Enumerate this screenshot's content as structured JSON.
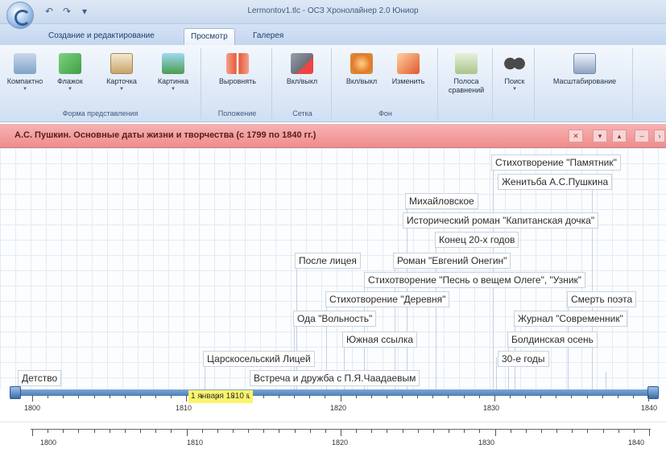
{
  "window": {
    "title": "Lermontov1.tlc - ОСЗ Хронолайнер 2.0 Юниор",
    "qat_undo": "↶",
    "qat_redo": "↷",
    "qat_more": "▾"
  },
  "tabs": [
    {
      "label": "Создание и редактирование",
      "active": false
    },
    {
      "label": "Просмотр",
      "active": true
    },
    {
      "label": "Галерея",
      "active": false
    }
  ],
  "ribbon": {
    "groups": [
      {
        "label": "Форма представления",
        "buttons": [
          {
            "label": "Компактно",
            "icon": "compact-view-icon",
            "color": "#7fa3c9"
          },
          {
            "label": "Флажок",
            "icon": "flag-icon",
            "color": "#3f9d45"
          },
          {
            "label": "Карточка",
            "icon": "card-icon",
            "color": "#c7a46a"
          },
          {
            "label": "Картинка",
            "icon": "picture-icon",
            "color": "#4a9d4f"
          }
        ]
      },
      {
        "label": "Положение",
        "buttons": [
          {
            "label": "Выровнять",
            "icon": "align-icon",
            "color": "#e55a3a"
          }
        ]
      },
      {
        "label": "Сетка",
        "buttons": [
          {
            "label": "Вкл/выкл",
            "icon": "grid-toggle-icon",
            "color": "#6b6f7a"
          }
        ]
      },
      {
        "label": "Фон",
        "buttons": [
          {
            "label": "Вкл/выкл",
            "icon": "background-toggle-icon",
            "color": "#e27a2a"
          },
          {
            "label": "Изменить",
            "icon": "background-edit-icon",
            "color": "#e0572f"
          }
        ]
      },
      {
        "label": "",
        "buttons": [
          {
            "label": "Полоса сравнений",
            "icon": "compare-strip-icon",
            "color": "#a9c58b"
          }
        ]
      },
      {
        "label": "",
        "buttons": [
          {
            "label": "Поиск",
            "icon": "binoculars-icon",
            "color": "#4a4a4a"
          }
        ]
      },
      {
        "label": "",
        "buttons": [
          {
            "label": "Масштабирование",
            "icon": "zoom-icon",
            "color": "#8da4c3"
          }
        ]
      }
    ]
  },
  "timeline": {
    "title": "А.С. Пушкин. Основные даты жизни и творчества (с 1799 по 1840 гг.)",
    "header_buttons": [
      "✕",
      "▾",
      "▴",
      "–",
      "›"
    ],
    "events": [
      {
        "label": "Стихотворение \"Памятник\""
      },
      {
        "label": "Женитьба А.С.Пушкина"
      },
      {
        "label": "Михайловское"
      },
      {
        "label": "Исторический роман \"Капитанская дочка\""
      },
      {
        "label": "Конец 20-х годов"
      },
      {
        "label": "После лицея"
      },
      {
        "label": "Роман \"Евгений Онегин\""
      },
      {
        "label": "Стихотворение \"Песнь о вещем Олеге\", \"Узник\""
      },
      {
        "label": "Стихотворение \"Деревня\""
      },
      {
        "label": "Смерть поэта"
      },
      {
        "label": "Ода \"Вольность\""
      },
      {
        "label": "Журнал \"Современник\""
      },
      {
        "label": "Южная ссылка"
      },
      {
        "label": "Болдинская осень"
      },
      {
        "label": "Царскосельский Лицей"
      },
      {
        "label": "30-е годы"
      },
      {
        "label": "Детство"
      },
      {
        "label": "Встреча и дружба с П.Я.Чаадаевым"
      }
    ],
    "cursor_label": "1 января 1810 г.",
    "axis_years": [
      "1800",
      "1810",
      "1820",
      "1830",
      "1840"
    ],
    "overview_years": [
      "1800",
      "1810",
      "1820",
      "1830",
      "1840"
    ]
  }
}
